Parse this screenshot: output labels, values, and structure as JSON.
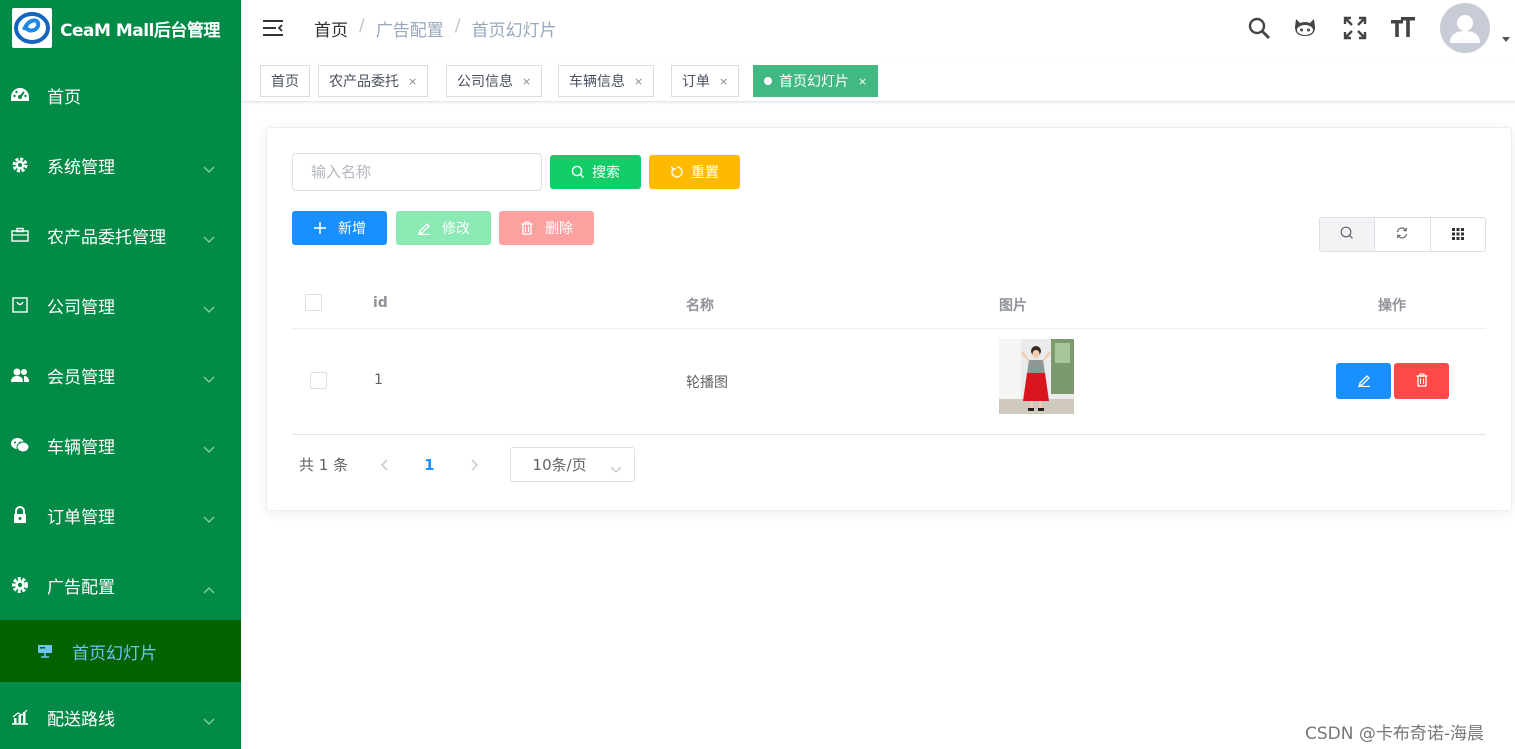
{
  "app": {
    "title": "CeaM Mall后台管理"
  },
  "sidebar": {
    "items": [
      {
        "label": "首页",
        "icon": "dashboard-icon"
      },
      {
        "label": "系统管理",
        "icon": "gear-icon"
      },
      {
        "label": "农产品委托管理",
        "icon": "briefcase-icon"
      },
      {
        "label": "公司管理",
        "icon": "shopping-bag-icon"
      },
      {
        "label": "会员管理",
        "icon": "users-icon"
      },
      {
        "label": "车辆管理",
        "icon": "wechat-icon"
      },
      {
        "label": "订单管理",
        "icon": "lock-icon"
      },
      {
        "label": "广告配置",
        "icon": "gear-icon"
      },
      {
        "label": "配送路线",
        "icon": "chart-icon"
      }
    ],
    "active_submenu": {
      "label": "首页幻灯片",
      "icon": "slides-icon"
    }
  },
  "header": {
    "breadcrumb": [
      "首页",
      "广告配置",
      "首页幻灯片"
    ]
  },
  "tags": [
    {
      "label": "首页",
      "closable": false
    },
    {
      "label": "农产品委托",
      "closable": true
    },
    {
      "label": "公司信息",
      "closable": true
    },
    {
      "label": "车辆信息",
      "closable": true
    },
    {
      "label": "订单",
      "closable": true
    },
    {
      "label": "首页幻灯片",
      "closable": true,
      "active": true
    }
  ],
  "tag_close": "×",
  "search": {
    "placeholder": "输入名称",
    "search_label": "搜索",
    "reset_label": "重置"
  },
  "toolbar": {
    "add_label": "新增",
    "edit_label": "修改",
    "delete_label": "删除"
  },
  "table": {
    "columns": [
      "id",
      "名称",
      "图片",
      "操作"
    ],
    "rows": [
      {
        "id": "1",
        "name": "轮播图"
      }
    ]
  },
  "pagination": {
    "total": "共 1 条",
    "current_page": "1",
    "page_size": "10条/页"
  },
  "watermark": "CSDN @卡布奇诺-海晨",
  "colors": {
    "sidebar_bg": "#028b46",
    "active_submenu_bg": "#036300",
    "active_tag": "#42b983",
    "primary": "#1890ff",
    "success": "#13ce66",
    "warning": "#ffba00",
    "danger": "#ff4949"
  }
}
